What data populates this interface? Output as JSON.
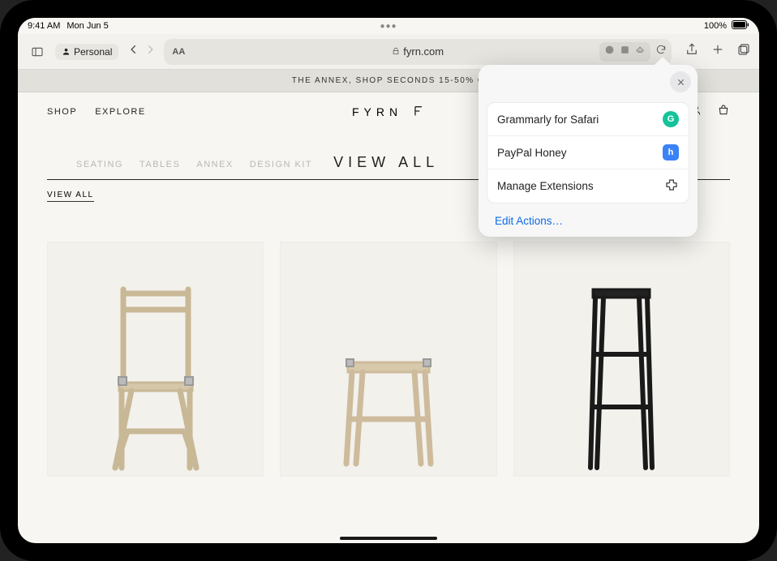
{
  "status": {
    "time": "9:41 AM",
    "date": "Mon Jun 5",
    "battery": "100%"
  },
  "toolbar": {
    "profile_label": "Personal",
    "aa_label": "AA",
    "url_label": "fyrn.com"
  },
  "site": {
    "promo_text": "THE ANNEX, SHOP SECONDS 15-50% O",
    "nav": {
      "shop": "SHOP",
      "explore": "EXPLORE"
    },
    "logo_word": "FYRN",
    "logo_mark": "╔",
    "categories": [
      "SEATING",
      "TABLES",
      "ANNEX",
      "DESIGN KIT"
    ],
    "view_all_big": "VIEW ALL",
    "view_all_small": "VIEW ALL"
  },
  "popover": {
    "items": [
      {
        "label": "Grammarly for Safari",
        "badge_letter": "G",
        "badge_class": "grammarly"
      },
      {
        "label": "PayPal Honey",
        "badge_letter": "h",
        "badge_class": "honey"
      }
    ],
    "manage_label": "Manage Extensions",
    "edit_actions": "Edit Actions…"
  }
}
